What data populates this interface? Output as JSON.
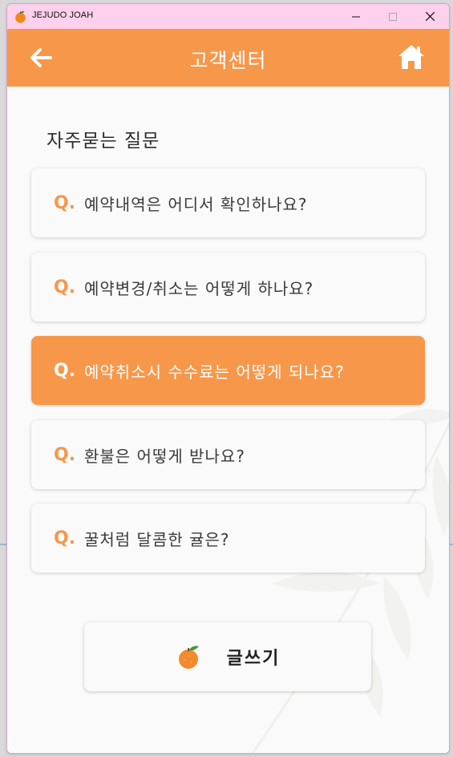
{
  "window": {
    "title": "JEJUDO JOAH",
    "controls": [
      "minimize",
      "maximize",
      "close"
    ]
  },
  "header": {
    "title": "고객센터",
    "back_icon": "arrow-left-icon",
    "home_icon": "home-icon"
  },
  "faq": {
    "section_title": "자주묻는 질문",
    "q_marker": "Q.",
    "items": [
      {
        "text": "예약내역은 어디서 확인하나요?",
        "active": false
      },
      {
        "text": "예약변경/취소는 어떻게 하나요?",
        "active": false
      },
      {
        "text": "예약취소시 수수료는 어떻게 되나요?",
        "active": true
      },
      {
        "text": "환불은 어떻게 받나요?",
        "active": false
      },
      {
        "text": "꿀처럼 달콤한 귤은?",
        "active": false
      }
    ]
  },
  "write_button": {
    "label": "글쓰기",
    "icon": "tangerine-icon"
  },
  "colors": {
    "accent": "#f7974a",
    "titlebar": "#fdd0eb",
    "background": "#fafafa"
  }
}
